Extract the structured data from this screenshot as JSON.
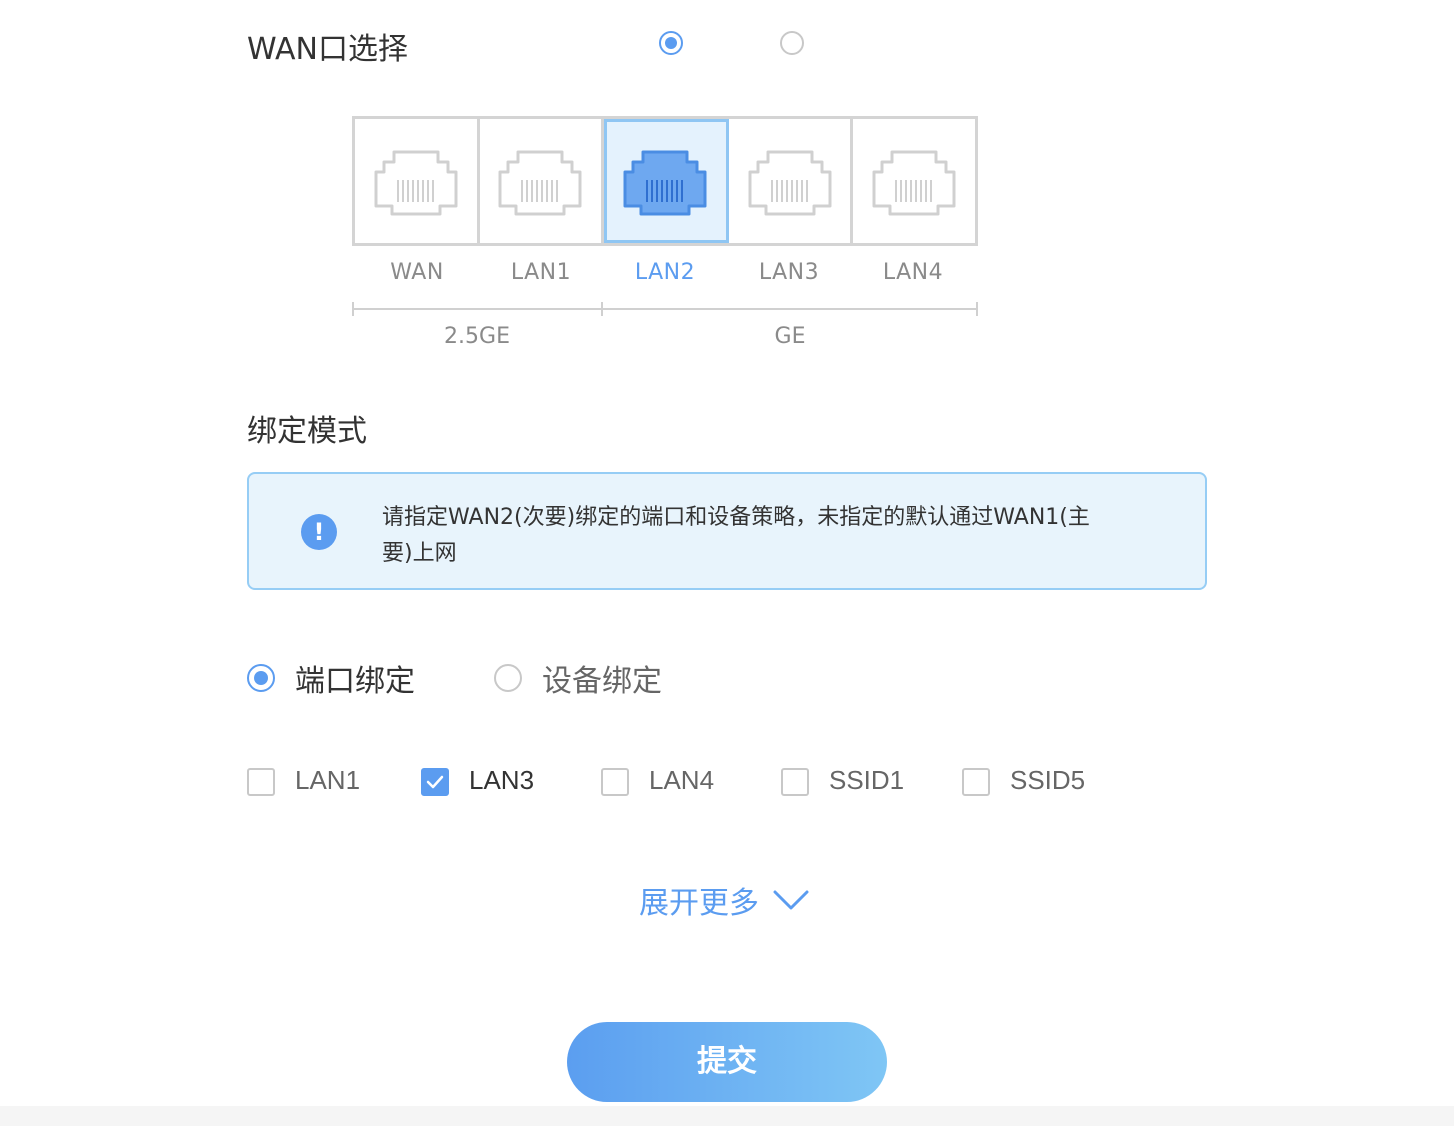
{
  "wan_select": {
    "title": "WAN口选择",
    "options": [
      {
        "selected": true
      },
      {
        "selected": false
      }
    ]
  },
  "ports": [
    {
      "label": "WAN",
      "selected": false
    },
    {
      "label": "LAN1",
      "selected": false
    },
    {
      "label": "LAN2",
      "selected": true
    },
    {
      "label": "LAN3",
      "selected": false
    },
    {
      "label": "LAN4",
      "selected": false
    }
  ],
  "speed_groups": [
    {
      "label": "2.5GE"
    },
    {
      "label": "GE"
    }
  ],
  "bind_mode": {
    "title": "绑定模式",
    "alert_icon": "exclamation-icon",
    "alert_text_line1": "请指定WAN2(次要)绑定的端口和设备策略，未指定的默认通过WAN1(主",
    "alert_text_line2": "要)上网",
    "modes": [
      {
        "label": "端口绑定",
        "selected": true
      },
      {
        "label": "设备绑定",
        "selected": false
      }
    ]
  },
  "port_options": [
    {
      "label": "LAN1",
      "checked": false
    },
    {
      "label": "LAN3",
      "checked": true
    },
    {
      "label": "LAN4",
      "checked": false
    },
    {
      "label": "SSID1",
      "checked": false
    },
    {
      "label": "SSID5",
      "checked": false
    }
  ],
  "expand_more": {
    "label": "展开更多",
    "icon": "chevron-down-icon"
  },
  "submit": {
    "label": "提交"
  },
  "colors": {
    "accent": "#5b9cf0",
    "alert_bg": "#e8f4fc",
    "alert_border": "#96cdf5"
  }
}
